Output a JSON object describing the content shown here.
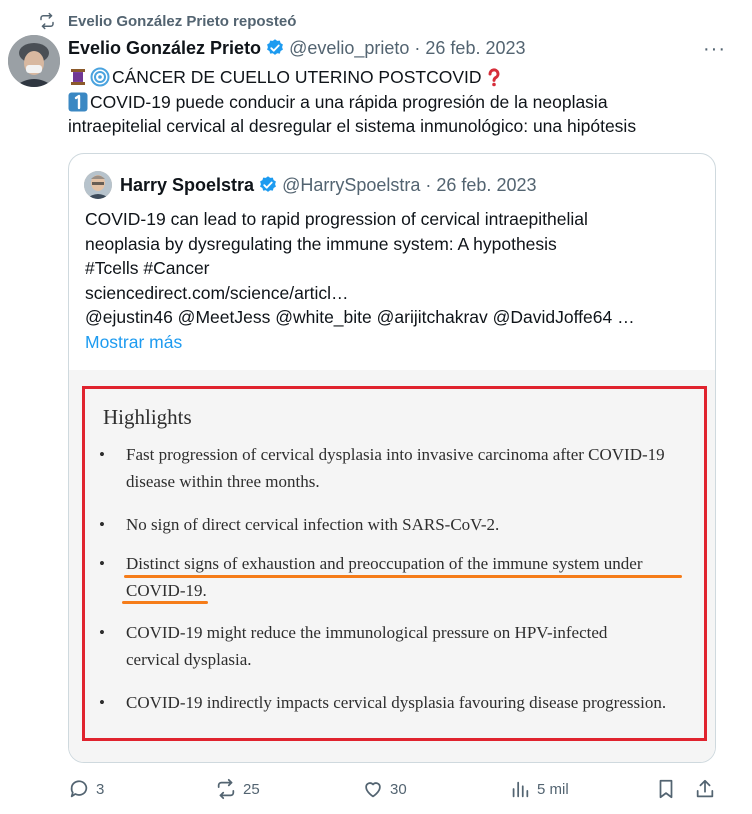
{
  "repost": {
    "text": "Evelio González Prieto reposteó",
    "icon": "repost-icon"
  },
  "tweet": {
    "author_name": "Evelio González Prieto",
    "handle": "@evelio_prieto",
    "date": "26 feb. 2023",
    "meta_sep": "·",
    "more_label": "···",
    "line1": "CÁNCER DE CUELLO UTERINO POSTCOVID",
    "line2": "COVID-19 puede conducir a una rápida progresión de la neoplasia",
    "line3": "intraepitelial cervical al desregular el sistema inmunológico: una hipótesis"
  },
  "quote": {
    "author_name": "Harry Spoelstra",
    "handle": "@HarrySpoelstra",
    "date": "26 feb. 2023",
    "meta_sep": "·",
    "lines": [
      "COVID-19 can lead to rapid progression of cervical intraepithelial",
      "neoplasia by dysregulating the immune system: A hypothesis",
      "#Tcells #Cancer",
      "sciencedirect.com/science/articl…",
      "@ejustin46 @MeetJess @white_bite @arijitchakrav @DavidJoffe64 …"
    ],
    "show_more": "Mostrar más"
  },
  "highlights": {
    "title": "Highlights",
    "bullet": "•",
    "items": [
      {
        "l1": "Fast progression of cervical dysplasia into invasive carcinoma after COVID-19",
        "l2": "disease within three months."
      },
      {
        "l1": "No sign of direct cervical infection with SARS-CoV-2.",
        "l2": ""
      },
      {
        "l1": "Distinct signs of exhaustion and preoccupation of the immune system under",
        "l2": "COVID-19."
      },
      {
        "l1": "COVID-19 might reduce the immunological pressure on HPV-infected",
        "l2": "cervical dysplasia."
      },
      {
        "l1": "COVID-19 indirectly impacts cervical dysplasia favouring disease progression.",
        "l2": ""
      }
    ]
  },
  "actions": {
    "replies": "3",
    "reposts": "25",
    "likes": "30",
    "views": "5 mil"
  },
  "colors": {
    "verified": "#1d9bf0",
    "annotation_box": "#e0232e",
    "annotation_underline": "#f57c19",
    "muted": "#536471"
  }
}
